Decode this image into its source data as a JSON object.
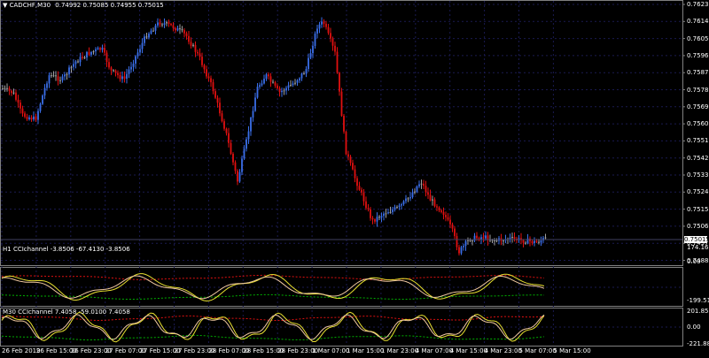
{
  "window": {
    "title": "CADCHF,M30",
    "quote": "0.74992 0.75085 0.74955 0.75015",
    "menu_arrow_glyph": "▼"
  },
  "price_axis": {
    "labels": [
      "0.76230",
      "0.76140",
      "0.76050",
      "0.75960",
      "0.75870",
      "0.75780",
      "0.75690",
      "0.75600",
      "0.75510",
      "0.75420",
      "0.75330",
      "0.75240",
      "0.75150",
      "0.75060",
      "0.74970",
      "0.74880"
    ],
    "current_price": "0.75015"
  },
  "indicator_h1": {
    "caption": "H1 CCIchannel -3.8506 -67.4130 -3.8506",
    "axis_labels": [
      "174.1682",
      "0.00",
      "-199.5141"
    ]
  },
  "indicator_m30": {
    "caption": "M30 CCIchannel 7.4058 -59.0100 7.4058",
    "axis_labels": [
      "201.8555",
      "0.00",
      "-221.8842"
    ]
  },
  "time_axis": {
    "labels": [
      "26 Feb 2019",
      "26 Feb 15:00",
      "26 Feb 23:00",
      "27 Feb 07:00",
      "27 Feb 15:00",
      "27 Feb 23:00",
      "28 Feb 07:00",
      "28 Feb 15:00",
      "28 Feb 23:00",
      "1 Mar 07:00",
      "1 Mar 15:00",
      "1 Mar 23:00",
      "4 Mar 07:00",
      "4 Mar 15:00",
      "4 Mar 23:00",
      "5 Mar 07:00",
      "5 Mar 15:00"
    ]
  },
  "colors": {
    "background": "#000000",
    "grid": "#1a1a50",
    "bull": "#3a6ee8",
    "bear": "#e01010",
    "neutral": "#a0a0a0",
    "cci_main": "#e8e030",
    "cci_signal": "#f0c8a0",
    "cci_upper": "#e01010",
    "cci_lower": "#00b000"
  }
}
